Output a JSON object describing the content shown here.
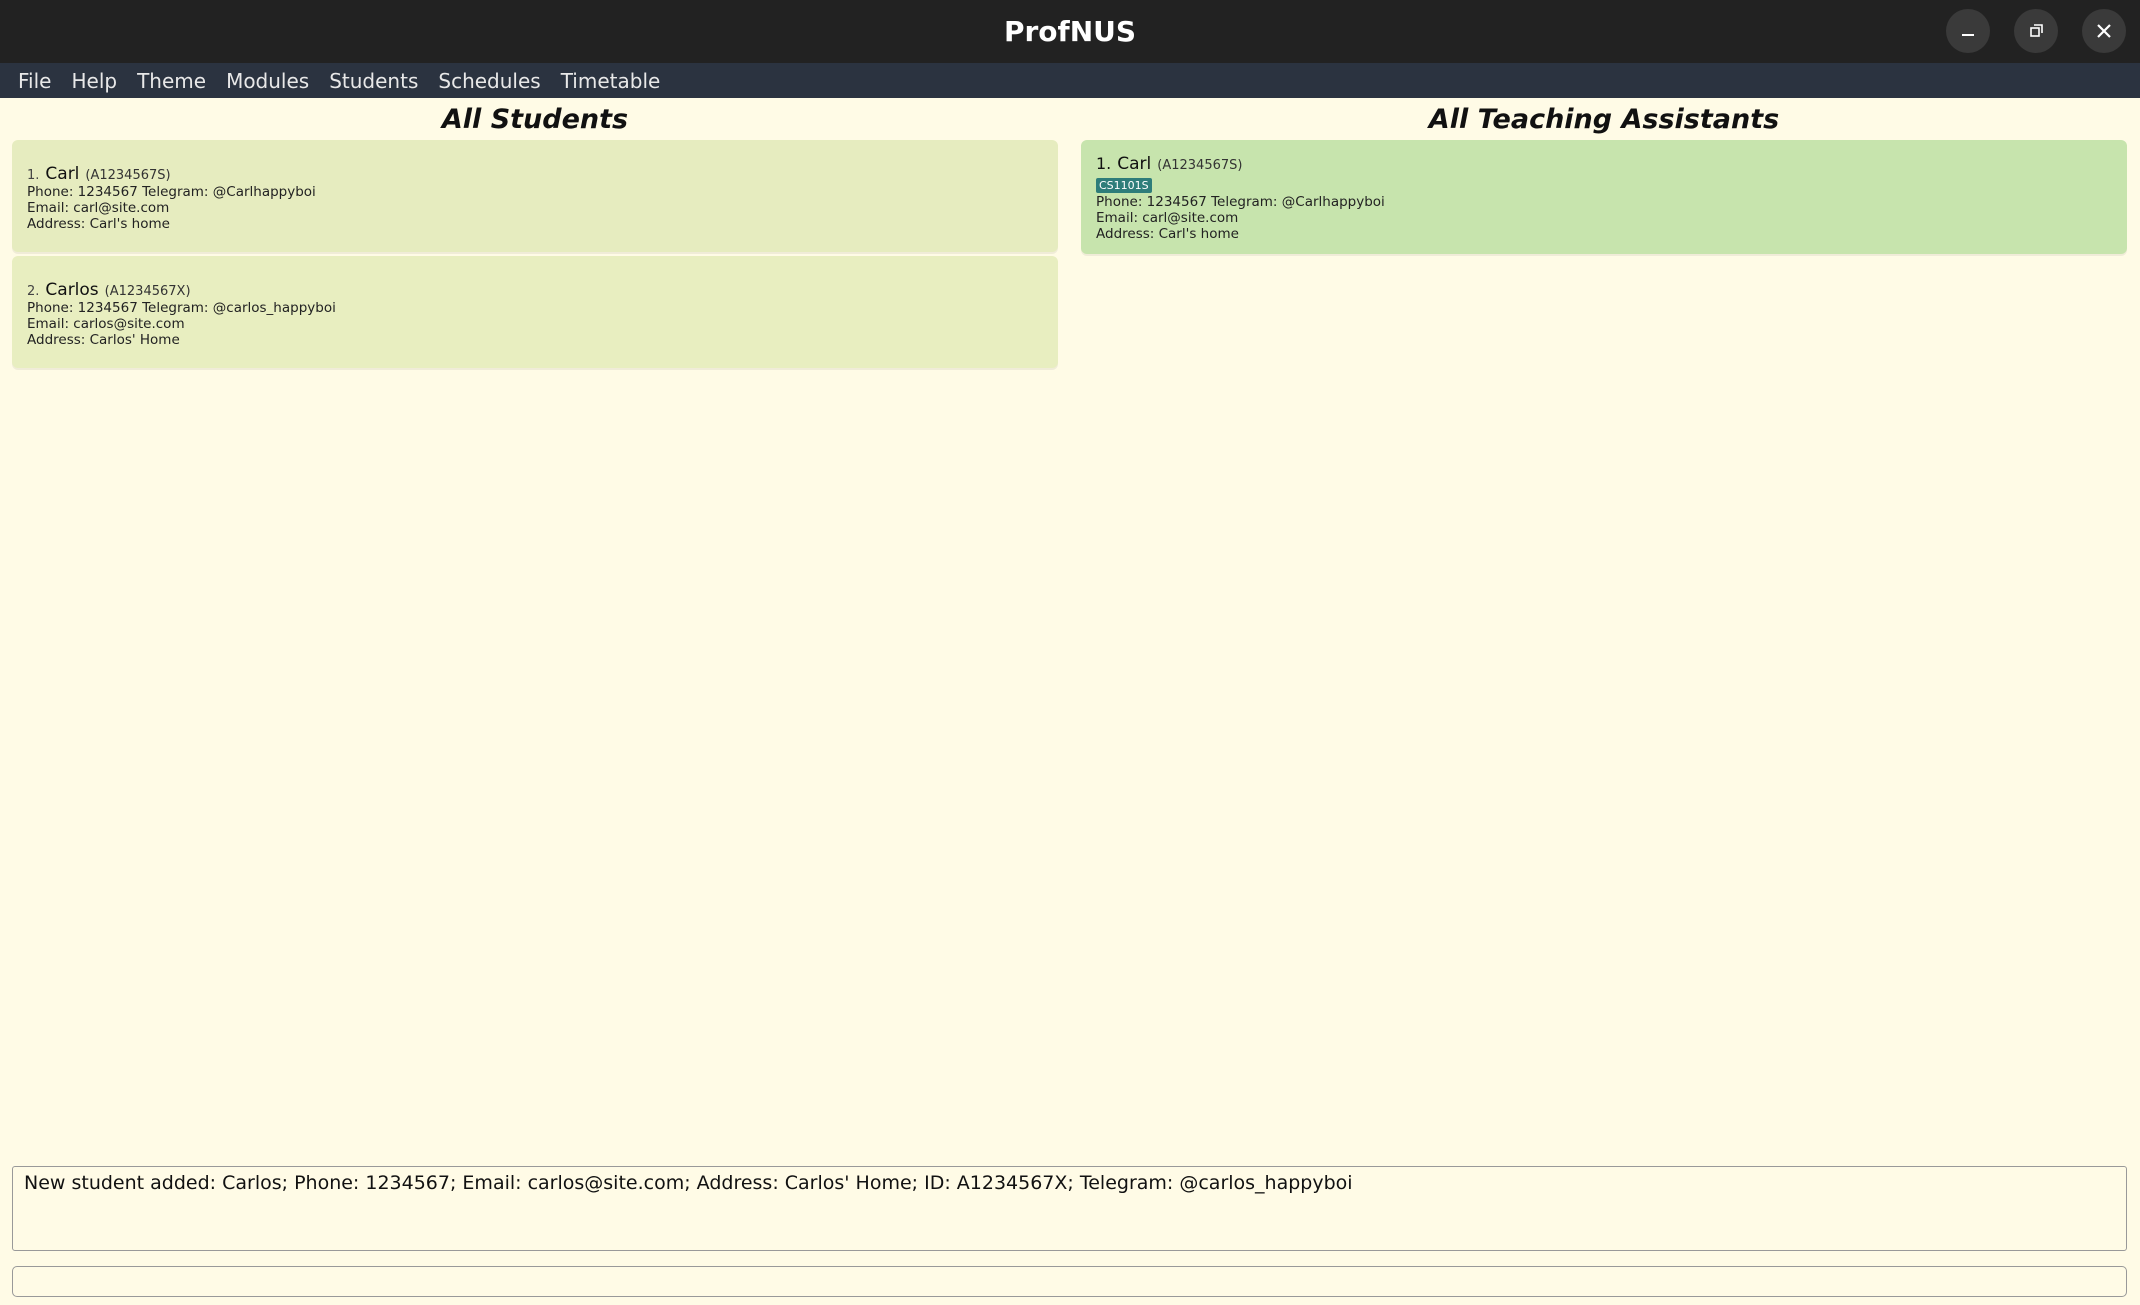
{
  "window": {
    "title": "ProfNUS"
  },
  "menu": [
    "File",
    "Help",
    "Theme",
    "Modules",
    "Students",
    "Schedules",
    "Timetable"
  ],
  "students_panel": {
    "title": "All Students",
    "cards": [
      {
        "index": "1.",
        "name": "Carl",
        "id": "(A1234567S)",
        "phone_telegram": "Phone: 1234567 Telegram: @Carlhappyboi",
        "email": "Email: carl@site.com",
        "address": "Address: Carl's home"
      },
      {
        "index": "2.",
        "name": "Carlos",
        "id": "(A1234567X)",
        "phone_telegram": "Phone: 1234567 Telegram: @carlos_happyboi",
        "email": "Email: carlos@site.com",
        "address": "Address: Carlos' Home"
      }
    ]
  },
  "ta_panel": {
    "title": "All Teaching Assistants",
    "cards": [
      {
        "index": "1.",
        "name": "Carl",
        "id": "(A1234567S)",
        "tag": "CS1101S",
        "phone_telegram": "Phone: 1234567 Telegram: @Carlhappyboi",
        "email": "Email: carl@site.com",
        "address": "Address: Carl's home"
      }
    ]
  },
  "result_display": {
    "text": "New student added: Carlos; Phone: 1234567; Email: carlos@site.com; Address: Carlos' Home; ID: A1234567X; Telegram: @carlos_happyboi"
  },
  "command_box": {
    "value": ""
  },
  "colors": {
    "background": "#fffbe6",
    "titlebar": "#222222",
    "menubar": "#2b3340",
    "student_card": "#e6ecbf",
    "ta_card": "#c7e4ad",
    "tag": "#2e7d7a"
  },
  "icons": [
    "minimize-icon",
    "maximize-icon",
    "close-icon"
  ]
}
